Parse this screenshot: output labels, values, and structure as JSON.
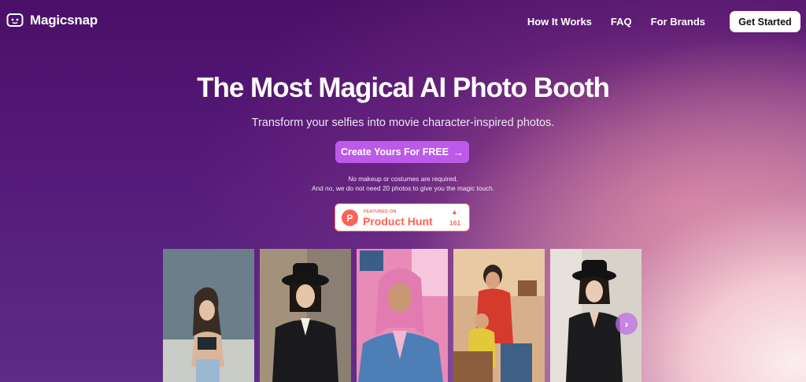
{
  "brand": {
    "name": "Magicsnap"
  },
  "nav": {
    "links": [
      "How It Works",
      "FAQ",
      "For Brands"
    ],
    "cta_label": "Get Started"
  },
  "hero": {
    "title": "The Most Magical AI Photo Booth",
    "subtitle": "Transform your selfies into movie character-inspired photos.",
    "cta_label": "Create Yours For FREE",
    "cta_icon": "arrow-right-icon",
    "note_line1": "No makeup or costumes are required.",
    "note_line2": "And no, we do not need 20 photos to give you the magic touch."
  },
  "product_hunt": {
    "featured_label": "FEATURED ON",
    "name": "Product Hunt",
    "logo_letter": "P",
    "upvotes": "161",
    "color": "#ff6154"
  },
  "gallery": {
    "next_icon": "chevron-right-icon"
  },
  "colors": {
    "accent": "#bd5ae9",
    "bg_top": "#4a1068",
    "bg_corner": "#fbeef0"
  }
}
